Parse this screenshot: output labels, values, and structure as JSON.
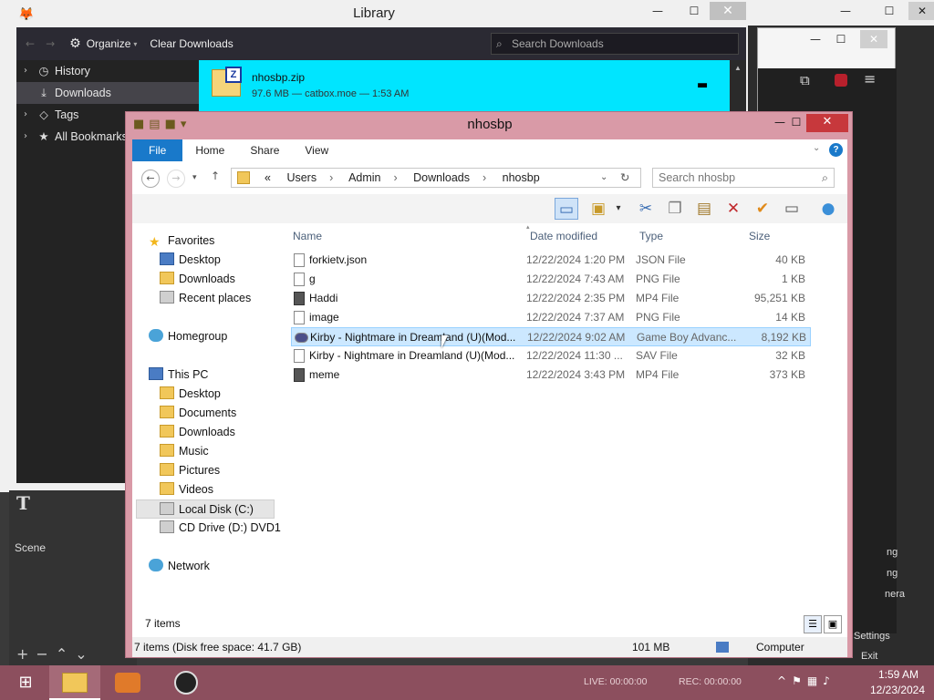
{
  "library": {
    "title": "Library",
    "organize": "Organize",
    "clear": "Clear Downloads",
    "search_placeholder": "Search Downloads",
    "sidebar": [
      {
        "label": "History",
        "icon": "history-icon"
      },
      {
        "label": "Downloads",
        "icon": "download-icon"
      },
      {
        "label": "Tags",
        "icon": "tag-icon"
      },
      {
        "label": "All Bookmarks",
        "icon": "star-icon"
      }
    ],
    "download": {
      "name": "nhosbp.zip",
      "meta": "97.6 MB — catbox.moe — 1:53 AM"
    }
  },
  "obs": {
    "scene_label": "Scene",
    "menu": [
      "ng",
      "ng",
      "nera",
      "Settings",
      "Exit"
    ]
  },
  "explorer": {
    "title": "nhosbp",
    "ribbon_tabs": [
      "File",
      "Home",
      "Share",
      "View"
    ],
    "path": [
      "Users",
      "Admin",
      "Downloads",
      "nhosbp"
    ],
    "path_prefix": "«",
    "search_placeholder": "Search nhosbp",
    "columns": {
      "name": "Name",
      "date": "Date modified",
      "type": "Type",
      "size": "Size"
    },
    "nav": {
      "favorites": "Favorites",
      "fav_items": [
        "Desktop",
        "Downloads",
        "Recent places"
      ],
      "homegroup": "Homegroup",
      "thispc": "This PC",
      "pc_items": [
        "Desktop",
        "Documents",
        "Downloads",
        "Music",
        "Pictures",
        "Videos",
        "Local Disk (C:)",
        "CD Drive (D:) DVD1"
      ],
      "network": "Network"
    },
    "files": [
      {
        "name": "forkietv.json",
        "date": "12/22/2024 1:20 PM",
        "type": "JSON File",
        "size": "40 KB",
        "kind": "doc"
      },
      {
        "name": "g",
        "date": "12/22/2024 7:43 AM",
        "type": "PNG File",
        "size": "1 KB",
        "kind": "doc"
      },
      {
        "name": "Haddi",
        "date": "12/22/2024 2:35 PM",
        "type": "MP4 File",
        "size": "95,251 KB",
        "kind": "vid"
      },
      {
        "name": "image",
        "date": "12/22/2024 7:37 AM",
        "type": "PNG File",
        "size": "14 KB",
        "kind": "doc"
      },
      {
        "name": "Kirby - Nightmare in Dreamland (U)(Mod...",
        "date": "12/22/2024 9:02 AM",
        "type": "Game Boy Advanc...",
        "size": "8,192 KB",
        "kind": "gb",
        "selected": true
      },
      {
        "name": "Kirby - Nightmare in Dreamland (U)(Mod...",
        "date": "12/22/2024 11:30 ...",
        "type": "SAV File",
        "size": "32 KB",
        "kind": "doc"
      },
      {
        "name": "meme",
        "date": "12/22/2024 3:43 PM",
        "type": "MP4 File",
        "size": "373 KB",
        "kind": "vid"
      }
    ],
    "item_count": "7 items",
    "status_left": "7 items (Disk free space: 41.7 GB)",
    "status_size": "101 MB",
    "status_loc": "Computer"
  },
  "taskbar": {
    "live": "LIVE: 00:00:00",
    "rec": "REC: 00:00:00",
    "time": "1:59 AM",
    "date": "12/23/2024"
  }
}
